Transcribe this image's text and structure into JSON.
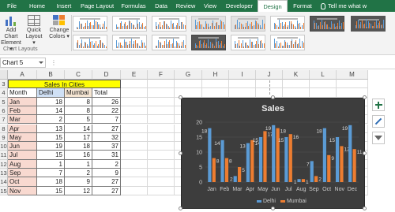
{
  "ribbon": {
    "tabs": [
      {
        "label": "File",
        "w": 30
      },
      {
        "label": "Home",
        "w": 34
      },
      {
        "label": "Insert",
        "w": 34
      },
      {
        "label": "Page Layout",
        "w": 50
      },
      {
        "label": "Formulas",
        "w": 42
      },
      {
        "label": "Data",
        "w": 28
      },
      {
        "label": "Review",
        "w": 34
      },
      {
        "label": "View",
        "w": 28
      },
      {
        "label": "Developer",
        "w": 46
      },
      {
        "label": "Design",
        "w": 38,
        "active": true
      },
      {
        "label": "Format",
        "w": 38
      }
    ],
    "tell_me": "Tell me what w",
    "add_chart_element": "Add Chart\nElement ▾",
    "quick_layout": "Quick\nLayout ▾",
    "change_colors": "Change\nColors ▾",
    "group_label": "Chart Layouts"
  },
  "formula_bar": {
    "name_box": "Chart 5",
    "dots": "⋮"
  },
  "sheet": {
    "columns": [
      "A",
      "B",
      "C",
      "D",
      "E",
      "F",
      "G",
      "H",
      "I",
      "J",
      "K",
      "L",
      "M"
    ],
    "rows": [
      "3",
      "4",
      "5",
      "6",
      "7",
      "8",
      "9",
      "10",
      "11",
      "12",
      "13",
      "14",
      "15"
    ],
    "table_title": "Sales In Cities",
    "headers": [
      "Month",
      "Delhi",
      "Mumbai",
      "Total"
    ],
    "data": [
      [
        "Jan",
        "18",
        "8",
        "26"
      ],
      [
        "Feb",
        "14",
        "8",
        "22"
      ],
      [
        "Mar",
        "2",
        "5",
        "7"
      ],
      [
        "Apr",
        "13",
        "14",
        "27"
      ],
      [
        "May",
        "15",
        "17",
        "32"
      ],
      [
        "Jun",
        "19",
        "18",
        "37"
      ],
      [
        "Jul",
        "15",
        "16",
        "31"
      ],
      [
        "Aug",
        "1",
        "1",
        "2"
      ],
      [
        "Sep",
        "7",
        "2",
        "9"
      ],
      [
        "Oct",
        "18",
        "9",
        "27"
      ],
      [
        "Nov",
        "15",
        "12",
        "27"
      ],
      [
        "Dec",
        "19",
        "11",
        "30"
      ]
    ]
  },
  "chart_data": {
    "type": "bar",
    "title": "Sales",
    "categories": [
      "Jan",
      "Feb",
      "Mar",
      "Apr",
      "May",
      "Jun",
      "Jul",
      "Aug",
      "Sep",
      "Oct",
      "Nov",
      "Dec"
    ],
    "series": [
      {
        "name": "Delhi",
        "values": [
          18,
          14,
          2,
          13,
          15,
          19,
          15,
          1,
          7,
          18,
          15,
          19
        ],
        "color": "#5b9bd5"
      },
      {
        "name": "Mumbai",
        "values": [
          8,
          8,
          5,
          14,
          17,
          18,
          16,
          1,
          2,
          9,
          12,
          11
        ],
        "color": "#ed7d31"
      }
    ],
    "yticks": [
      "0",
      "5",
      "10",
      "15",
      "20"
    ],
    "ylim": [
      0,
      20
    ],
    "legend": "bottom"
  },
  "side_buttons": [
    "plus-icon",
    "brush-icon",
    "filter-icon"
  ]
}
